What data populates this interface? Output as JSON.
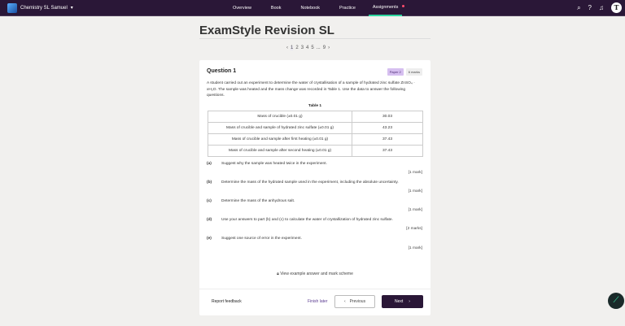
{
  "nav": {
    "course": "Chemistry SL Samuel",
    "tabs": [
      "Overview",
      "Book",
      "Notebook",
      "Practice",
      "Assignments"
    ],
    "avatar": "T"
  },
  "title": "ExamStyle Revision SL",
  "pager": {
    "pages": [
      "1",
      "2",
      "3",
      "4",
      "5",
      "...",
      "9"
    ]
  },
  "question": {
    "title": "Question 1",
    "paper": "Paper 2",
    "marks": "6 marks",
    "intro": "A student carried out an experiment to determine the water of crystallisation of a sample of hydrated zinc sulfate ZnSO₄ · xH₂O. The sample was heated and the mass change was recorded in Table 1. Use the data to answer the following questions.",
    "table_caption": "Table 1",
    "rows": [
      [
        "Mass of crucible (±0.01 g)",
        "30.03"
      ],
      [
        "Mass of crucible and sample of hydrated zinc sulfate (±0.01 g)",
        "43.23"
      ],
      [
        "Mass of crucible and sample after first heating (±0.01 g)",
        "37.43"
      ],
      [
        "Mass of crucible and sample after second heating (±0.01 g)",
        "37.43"
      ]
    ],
    "parts": [
      {
        "label": "(a)",
        "text": "Suggest why the sample was heated twice in the experiment.",
        "marks": "[1 mark]"
      },
      {
        "label": "(b)",
        "text": "Determine the mass of the hydrated sample used in the experiment, including the absolute uncertainty.",
        "marks": "[1 mark]"
      },
      {
        "label": "(c)",
        "text": "Determine the mass of the anhydrous salt.",
        "marks": "[1 mark]"
      },
      {
        "label": "(d)",
        "text": "Use your answers to part (b) and (c) to calculate the water of crystallization of hydrated zinc sulfate.",
        "marks": "[2 marks]"
      },
      {
        "label": "(e)",
        "text": "Suggest one source of error in the experiment.",
        "marks": "[1 mark]"
      }
    ],
    "view_answer": "View example answer and mark scheme"
  },
  "footer": {
    "report": "Report feedback",
    "finish": "Finish later",
    "previous": "Previous",
    "next": "Next"
  }
}
